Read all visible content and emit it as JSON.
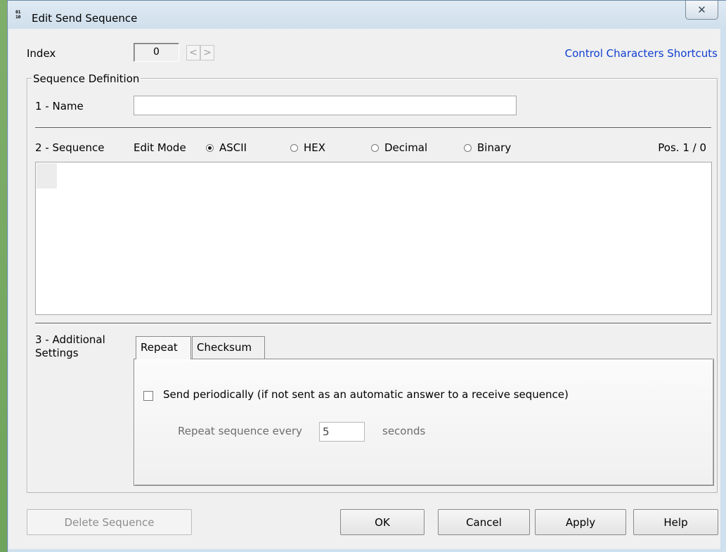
{
  "window": {
    "title": "Edit Send Sequence",
    "close_glyph": "☒",
    "app_icon_text": "0101\n1010"
  },
  "index": {
    "label": "Index",
    "value": "0",
    "prev": "<",
    "next": ">"
  },
  "link": {
    "control_chars": "Control Characters Shortcuts"
  },
  "definition": {
    "legend": "Sequence Definition",
    "name_label": "1 - Name",
    "name_value": ""
  },
  "sequence": {
    "label": "2 - Sequence",
    "edit_mode_label": "Edit Mode",
    "modes": [
      {
        "label": "ASCII",
        "selected": true
      },
      {
        "label": "HEX",
        "selected": false
      },
      {
        "label": "Decimal",
        "selected": false
      },
      {
        "label": "Binary",
        "selected": false
      }
    ],
    "position": "Pos. 1 / 0"
  },
  "additional": {
    "label_line1": "3 - Additional",
    "label_line2": "Settings",
    "tabs": [
      {
        "label": "Repeat",
        "active": true
      },
      {
        "label": "Checksum",
        "active": false
      }
    ],
    "send_periodically_label": "Send periodically  (if not sent as an automatic answer to a receive sequence)",
    "send_periodically_checked": false,
    "repeat_every_label": "Repeat sequence every",
    "repeat_value": "5",
    "seconds_label": "seconds"
  },
  "buttons": {
    "delete": "Delete Sequence",
    "ok": "OK",
    "cancel": "Cancel",
    "apply": "Apply",
    "help": "Help"
  }
}
